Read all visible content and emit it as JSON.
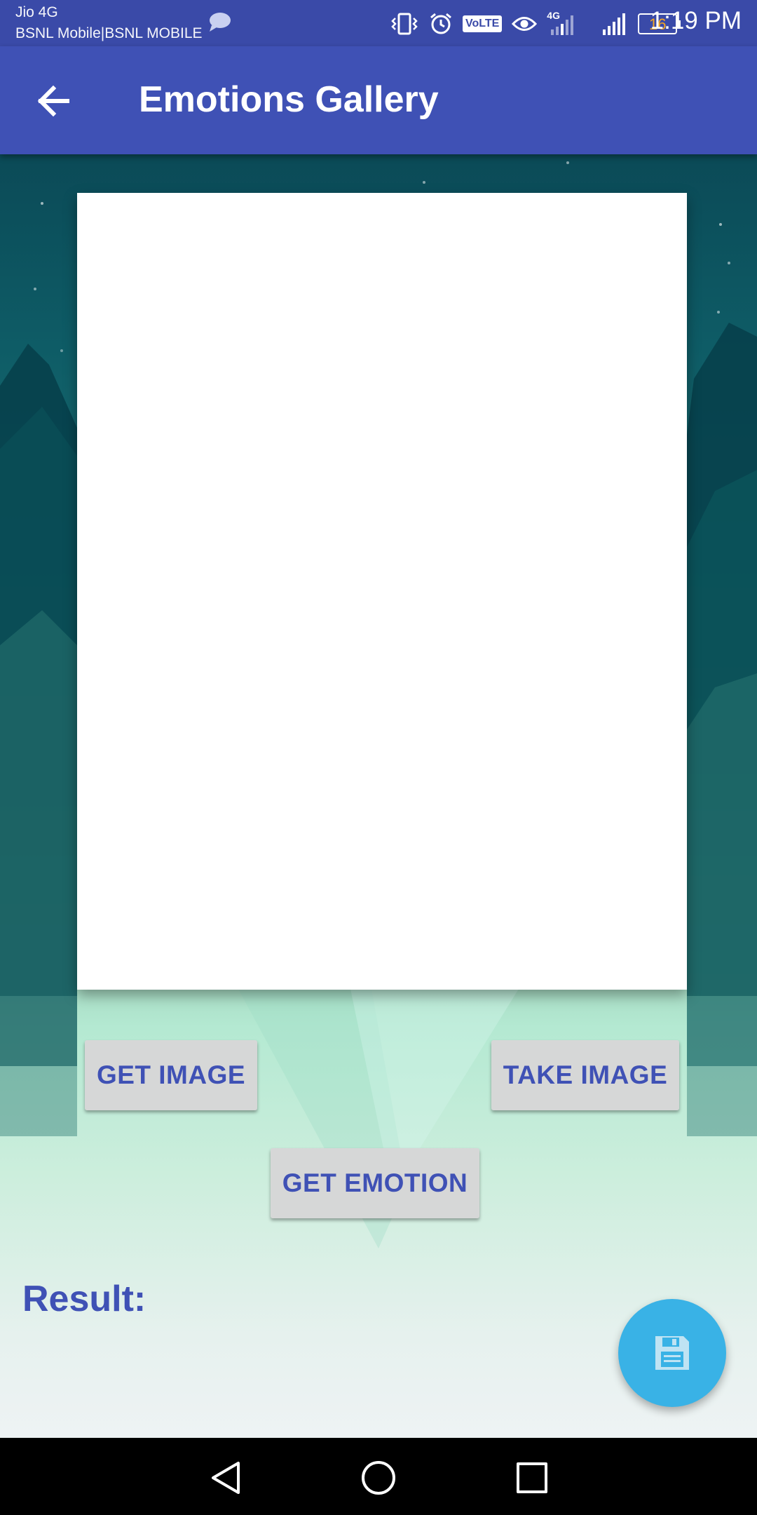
{
  "status_bar": {
    "carrier_primary": "Jio 4G",
    "carrier_secondary": "BSNL Mobile|BSNL MOBILE",
    "volte_label": "VoLTE",
    "network_label": "4G",
    "battery_level": "16",
    "time": "1:19 PM",
    "icons": [
      "message-icon",
      "vibrate-icon",
      "alarm-icon",
      "volte-icon",
      "eye-icon",
      "signal-4g-icon",
      "signal-icon",
      "battery-icon"
    ]
  },
  "app_bar": {
    "title": "Emotions Gallery",
    "back_icon": "arrow-back-icon"
  },
  "buttons": {
    "get_image": "GET IMAGE",
    "take_image": "TAKE IMAGE",
    "get_emotion": "GET EMOTION"
  },
  "result": {
    "label": "Result:"
  },
  "fab": {
    "icon": "save-icon"
  },
  "nav_bar": {
    "icons": [
      "back-triangle-icon",
      "home-circle-icon",
      "recents-square-icon"
    ]
  },
  "colors": {
    "primary": "#3f51b5",
    "status_bar": "#3a4aa8",
    "fab": "#39b2e6",
    "button_bg": "#d6d7d7",
    "battery_text": "#f5a623"
  }
}
